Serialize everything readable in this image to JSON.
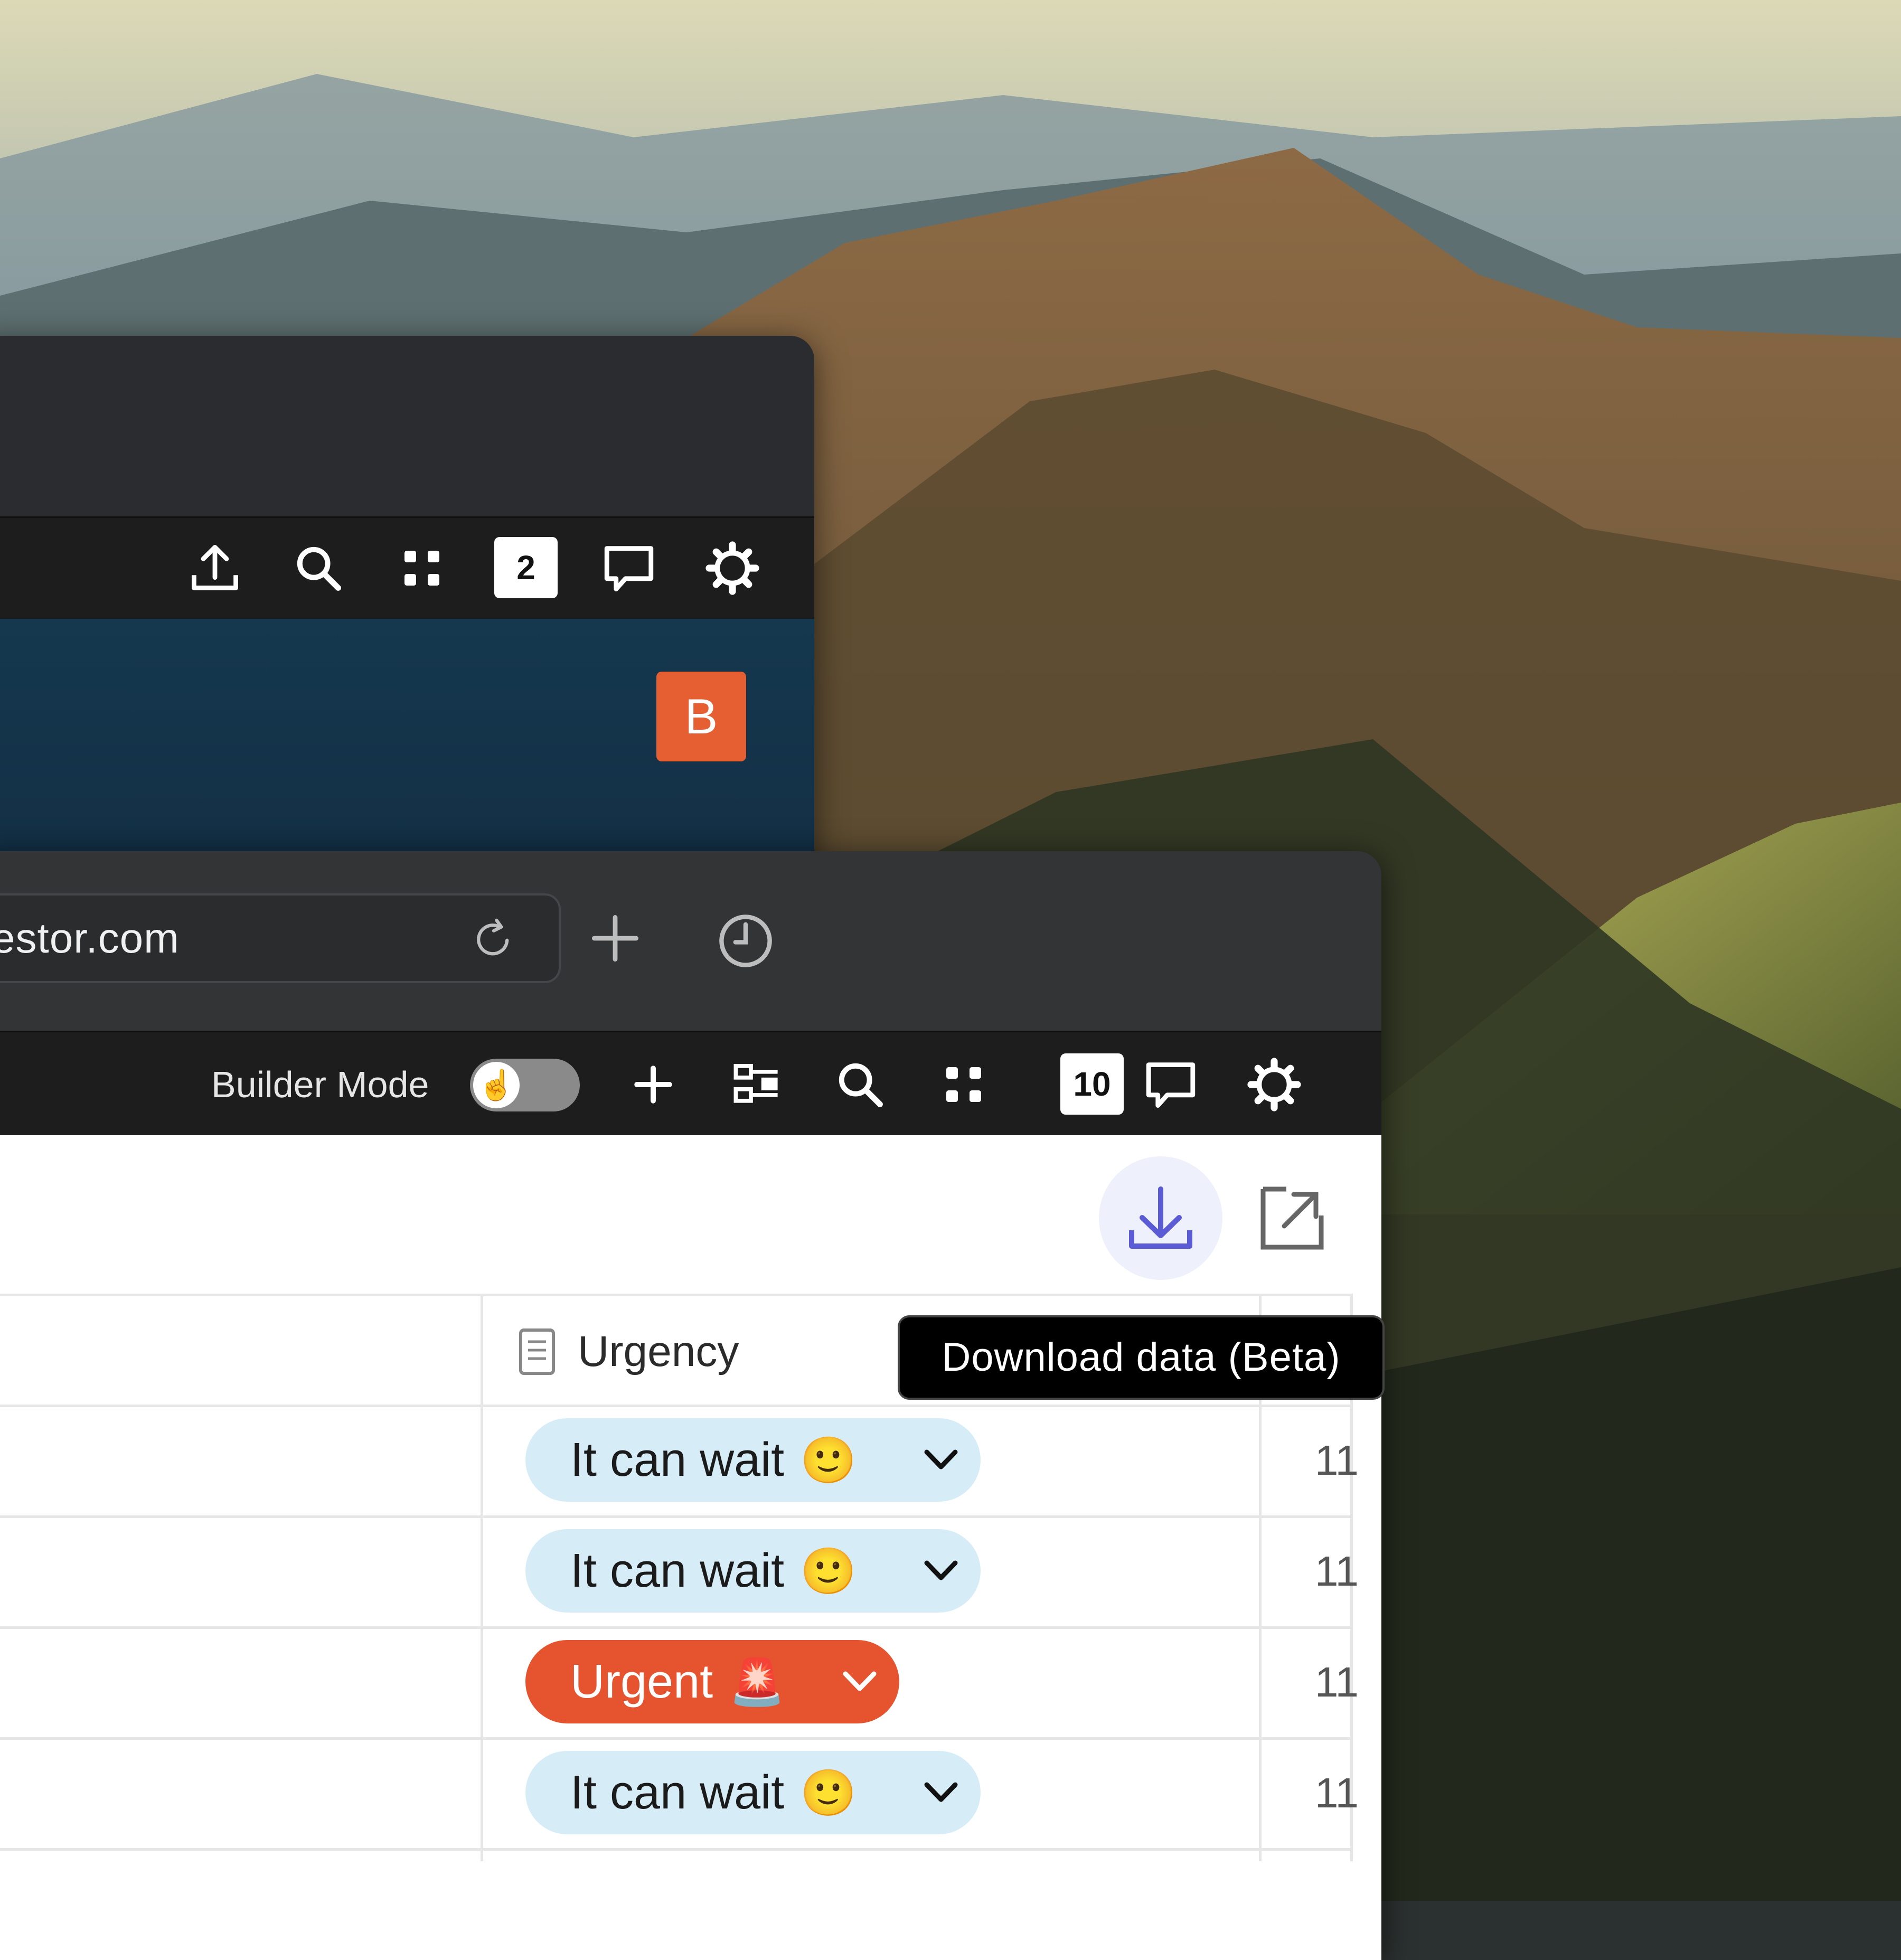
{
  "back_window": {
    "toolbar": {
      "notification_count": "2"
    },
    "user_avatar_initial": "B"
  },
  "front_window": {
    "url": "estor.com",
    "toolbar": {
      "builder_mode_label": "Builder Mode",
      "builder_mode_enabled": false,
      "notification_count": "10"
    },
    "table": {
      "column_header": "Urgency",
      "rows": [
        {
          "urgency": "It can wait",
          "emoji": "🙂",
          "next_value": "11",
          "style": "wait"
        },
        {
          "urgency": "It can wait",
          "emoji": "🙂",
          "next_value": "11",
          "style": "wait"
        },
        {
          "urgency": "Urgent",
          "emoji": "🚨",
          "next_value": "11",
          "style": "urgent"
        },
        {
          "urgency": "It can wait",
          "emoji": "🙂",
          "next_value": "11",
          "style": "wait"
        }
      ]
    },
    "tooltip": "Download data (Beta)"
  },
  "colors": {
    "avatar": "#e55f33",
    "urgent_pill": "#e5532f",
    "wait_pill": "#d6edf8",
    "download_accent": "#5b5bd6"
  }
}
